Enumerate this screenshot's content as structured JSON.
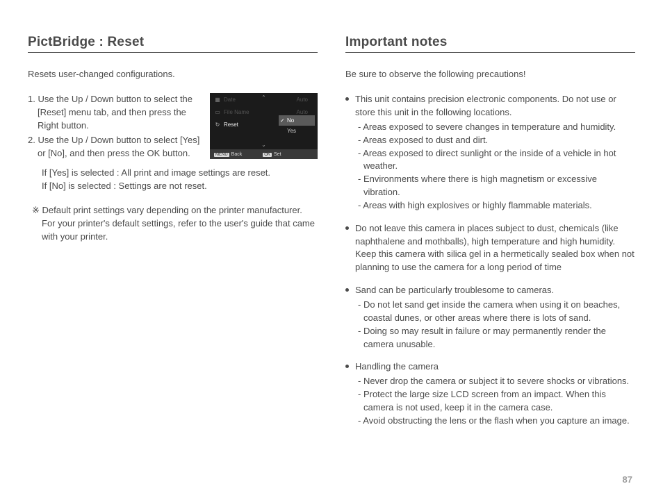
{
  "page_number": "87",
  "left": {
    "heading": "PictBridge : Reset",
    "intro": "Resets user-changed configurations.",
    "steps": [
      "1. Use the Up / Down button to select the [Reset] menu tab, and then press the Right button.",
      "2. Use the Up / Down button to select [Yes] or [No], and then press the OK button."
    ],
    "conditions": [
      "If [Yes] is selected : All print and image settings are reset.",
      "If [No] is selected  : Settings are not reset."
    ],
    "footnote": "※ Default print settings vary depending on the printer manufacturer. For your printer's default settings, refer to the user's guide that came with your printer.",
    "screenshot": {
      "rows": [
        {
          "icon": "calendar-icon",
          "label": "Date",
          "value": "Auto"
        },
        {
          "icon": "file-icon",
          "label": "File Name",
          "value": "Auto"
        },
        {
          "icon": "reset-icon",
          "label": "Reset",
          "value": ""
        }
      ],
      "options": {
        "selected": "No",
        "other": "Yes"
      },
      "footer": {
        "back_btn": "MENU",
        "back": "Back",
        "set_btn": "OK",
        "set": "Set"
      }
    }
  },
  "right": {
    "heading": "Important notes",
    "intro": "Be sure to observe the following precautions!",
    "bullets": [
      {
        "text": "This unit contains precision electronic components. Do not use or store this unit in the following locations.",
        "subs": [
          "- Areas exposed to severe changes in temperature and humidity.",
          "- Areas exposed to dust and dirt.",
          "- Areas exposed to direct sunlight or the inside of a vehicle in hot weather.",
          "- Environments where there is high magnetism or excessive vibration.",
          "- Areas with high explosives or highly flammable materials."
        ]
      },
      {
        "text": "Do not leave this camera in places subject to dust, chemicals (like naphthalene and mothballs), high temperature and high humidity. Keep this camera with silica gel in a hermetically sealed box when not planning to use the camera for a long period of time",
        "subs": []
      },
      {
        "text": "Sand can be particularly troublesome to cameras.",
        "subs": [
          "- Do not let sand get inside the camera when using it on beaches, coastal dunes, or other areas where there is lots of sand.",
          "- Doing so may result in failure or may permanently render the camera unusable."
        ]
      },
      {
        "text": "Handling the camera",
        "subs": [
          "- Never drop the camera or subject it to severe shocks or vibrations.",
          "- Protect the large size LCD screen from an impact. When this camera is not used, keep it in the camera case.",
          "- Avoid obstructing the lens or the flash when you capture an image."
        ]
      }
    ]
  }
}
